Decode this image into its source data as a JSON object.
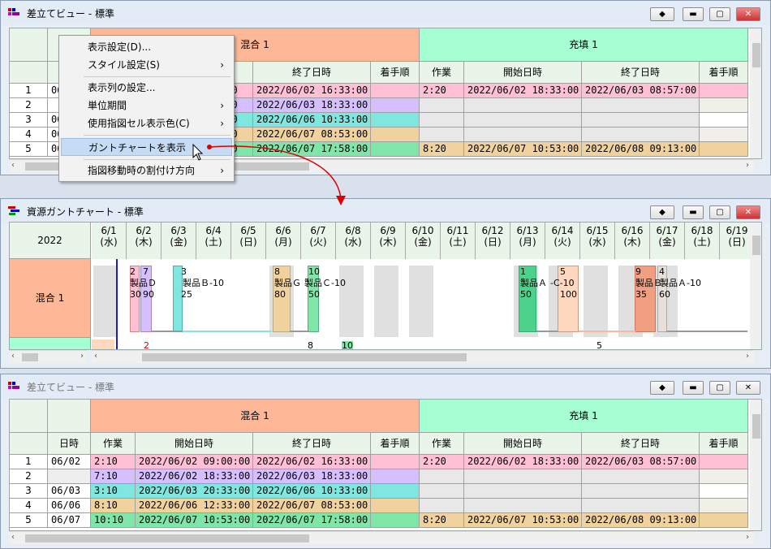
{
  "win1": {
    "title": "差立てビュー - 標準"
  },
  "win2": {
    "title": "資源ガントチャート - 標準"
  },
  "win3": {
    "title": "差立てビュー - 標準"
  },
  "header": {
    "group1": "混合 1",
    "group2": "充填 1",
    "date": "日時",
    "work": "作業",
    "start": "開始日時",
    "end": "終了日時",
    "order": "着手順"
  },
  "rows": [
    {
      "n": "1",
      "date": "06/02",
      "w1": "2:10",
      "s1": "2022/06/02 09:00:00",
      "e1": "2022/06/02 16:33:00",
      "w2": "2:20",
      "s2": "2022/06/02 18:33:00",
      "e2": "2022/06/03 08:57:00"
    },
    {
      "n": "2",
      "date": "",
      "w1": "7:10",
      "s1": "2022/06/02 18:33:00",
      "e1": "2022/06/03 18:33:00",
      "w2": "",
      "s2": "",
      "e2": ""
    },
    {
      "n": "3",
      "date": "06/03",
      "w1": "3:10",
      "s1": "2022/06/03 20:33:00",
      "e1": "2022/06/06 10:33:00",
      "w2": "",
      "s2": "",
      "e2": ""
    },
    {
      "n": "4",
      "date": "06/06",
      "w1": "8:10",
      "s1": "2022/06/06 12:33:00",
      "e1": "2022/06/07 08:53:00",
      "w2": "",
      "s2": "",
      "e2": ""
    },
    {
      "n": "5",
      "date": "06/07",
      "w1": "10:10",
      "s1": "2022/06/07 10:53:00",
      "e1": "2022/06/07 17:58:00",
      "w2": "8:20",
      "s2": "2022/06/07 10:53:00",
      "e2": "2022/06/08 09:13:00"
    }
  ],
  "top_rows": {
    "d1": "06",
    "d3": "06",
    "d4": "06",
    "d5": "06",
    "e1": ":00",
    "e2": ":00",
    "e3": ":00",
    "e4": ":00",
    "e5": ":00"
  },
  "menu": {
    "items": [
      "表示設定(D)...",
      "スタイル設定(S)",
      "表示列の設定...",
      "単位期間",
      "使用指図セル表示色(C)",
      "ガントチャートを表示",
      "指図移動時の割付け方向"
    ]
  },
  "gantt": {
    "year": "2022",
    "resource": "混合 1",
    "days": [
      {
        "d": "6/1",
        "w": "(水)"
      },
      {
        "d": "6/2",
        "w": "(木)"
      },
      {
        "d": "6/3",
        "w": "(金)"
      },
      {
        "d": "6/4",
        "w": "(土)"
      },
      {
        "d": "6/5",
        "w": "(日)"
      },
      {
        "d": "6/6",
        "w": "(月)"
      },
      {
        "d": "6/7",
        "w": "(火)"
      },
      {
        "d": "6/8",
        "w": "(水)"
      },
      {
        "d": "6/9",
        "w": "(木)"
      },
      {
        "d": "6/10",
        "w": "(金)"
      },
      {
        "d": "6/11",
        "w": "(土)"
      },
      {
        "d": "6/12",
        "w": "(日)"
      },
      {
        "d": "6/13",
        "w": "(月)"
      },
      {
        "d": "6/14",
        "w": "(火)"
      },
      {
        "d": "6/15",
        "w": "(水)"
      },
      {
        "d": "6/16",
        "w": "(木)"
      },
      {
        "d": "6/17",
        "w": "(金)"
      },
      {
        "d": "6/18",
        "w": "(土)"
      },
      {
        "d": "6/19",
        "w": "(日)"
      }
    ],
    "labels": {
      "n2": "2",
      "n7": "7",
      "n3": "3",
      "n8": "8",
      "n10": "10",
      "n1": "1",
      "n5": "5",
      "n9": "9",
      "n4": "4",
      "pD": "製品Ｄ",
      "pB": "製品Ｂ-10",
      "pG": "製品Ｇ",
      "pC1": "製品Ｃ-10",
      "pA1": "製品Ａ",
      "pC2": "-C-10",
      "pB2": "製品Ｂ",
      "pA2": "製品Ａ-10",
      "q30": "30",
      "q90": "90",
      "q25": "25",
      "q80": "80",
      "q50a": "50",
      "q50b": "50",
      "q100": "100",
      "q35": "35",
      "q60": "60",
      "b2": "2",
      "b8": "8",
      "b10": "10",
      "b5": "5"
    }
  },
  "colors": {
    "mix": "#ffb897",
    "fill": "#a6ffd2",
    "pink": "#ffc0d6",
    "purple": "#d6bfff",
    "cyan": "#7fe6e0",
    "tan": "#f0d29e",
    "green": "#7fe6a8"
  }
}
